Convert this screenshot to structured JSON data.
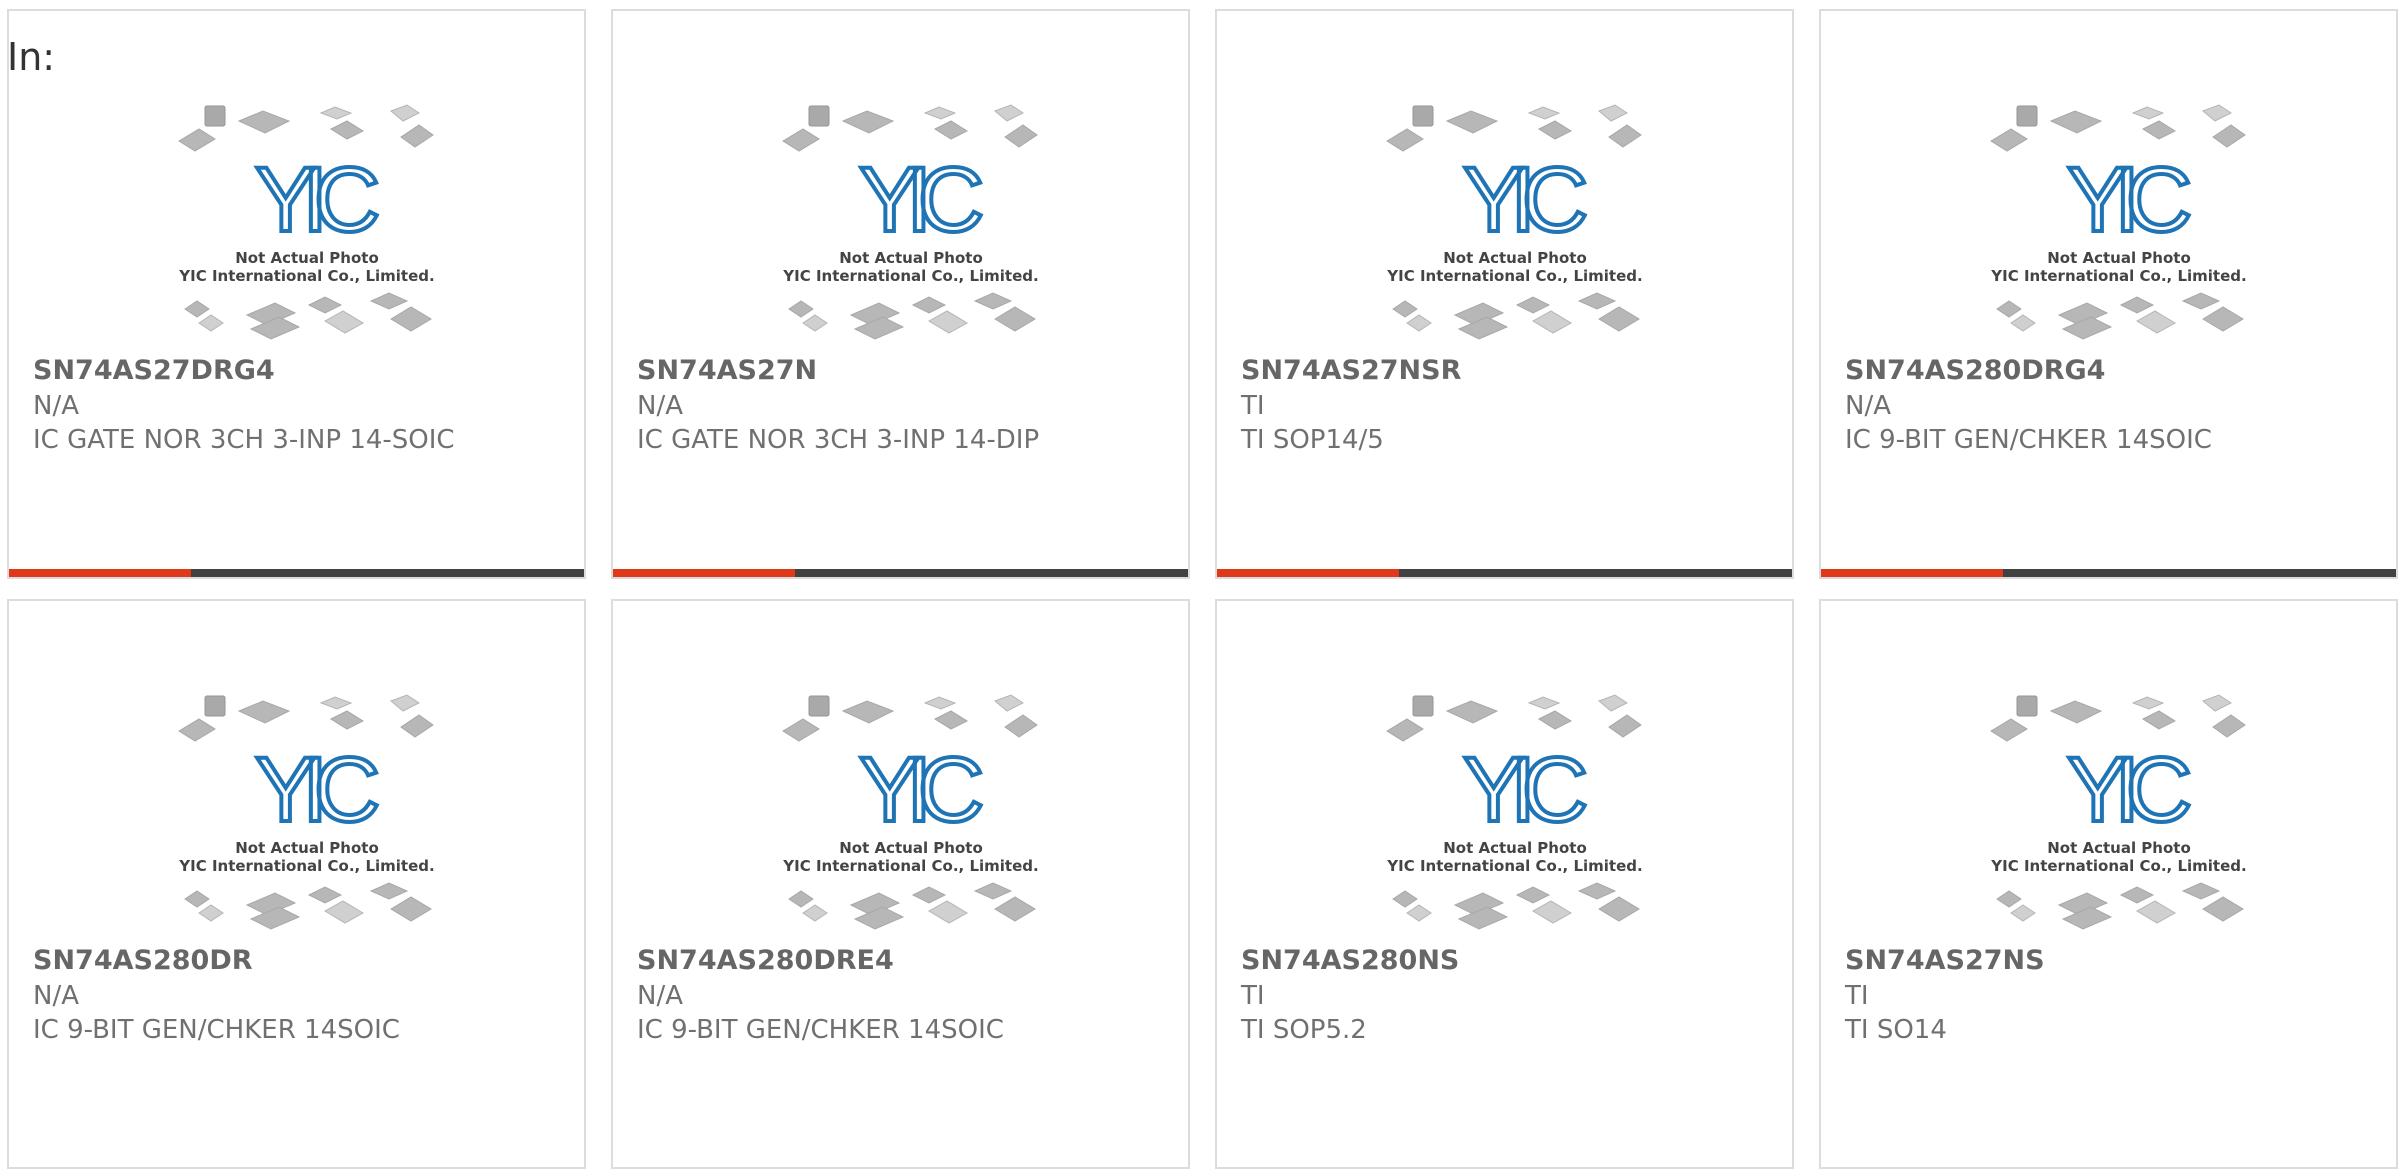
{
  "heading": {
    "label": "In:"
  },
  "image": {
    "caption_line1": "Not Actual Photo",
    "caption_line2": "YIC International Co., Limited.",
    "logo_text": "YIC"
  },
  "colors": {
    "accent": "#e0391a",
    "bar_dark": "#414141",
    "logo_blue": "#1f74b5",
    "card_border": "#dcdcdc",
    "text_gray": "#707070"
  },
  "cards": [
    {
      "part_number": "SN74AS27DRG4",
      "manufacturer": "N/A",
      "description": "IC GATE NOR 3CH 3-INP 14-SOIC",
      "accent": true
    },
    {
      "part_number": "SN74AS27N",
      "manufacturer": "N/A",
      "description": "IC GATE NOR 3CH 3-INP 14-DIP",
      "accent": true
    },
    {
      "part_number": "SN74AS27NSR",
      "manufacturer": "TI",
      "description": "TI SOP14/5",
      "accent": true
    },
    {
      "part_number": "SN74AS280DRG4",
      "manufacturer": "N/A",
      "description": "IC 9-BIT GEN/CHKER 14SOIC",
      "accent": true
    },
    {
      "part_number": "SN74AS280DR",
      "manufacturer": "N/A",
      "description": "IC 9-BIT GEN/CHKER 14SOIC",
      "accent": false
    },
    {
      "part_number": "SN74AS280DRE4",
      "manufacturer": "N/A",
      "description": "IC 9-BIT GEN/CHKER 14SOIC",
      "accent": false
    },
    {
      "part_number": "SN74AS280NS",
      "manufacturer": "TI",
      "description": "TI SOP5.2",
      "accent": false
    },
    {
      "part_number": "SN74AS27NS",
      "manufacturer": "TI",
      "description": "TI SO14",
      "accent": false
    }
  ]
}
